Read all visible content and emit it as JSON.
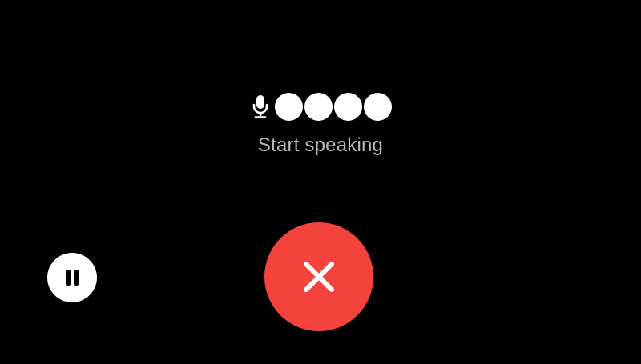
{
  "status": {
    "text": "Start speaking",
    "level_dots_active": 4
  },
  "icons": {
    "microphone": "microphone-icon",
    "pause": "pause-icon",
    "close": "close-icon"
  },
  "colors": {
    "background": "#000000",
    "status_text": "#b9b9b9",
    "cancel_button": "#f4433c",
    "pause_button": "#ffffff",
    "dots": "#ffffff"
  }
}
